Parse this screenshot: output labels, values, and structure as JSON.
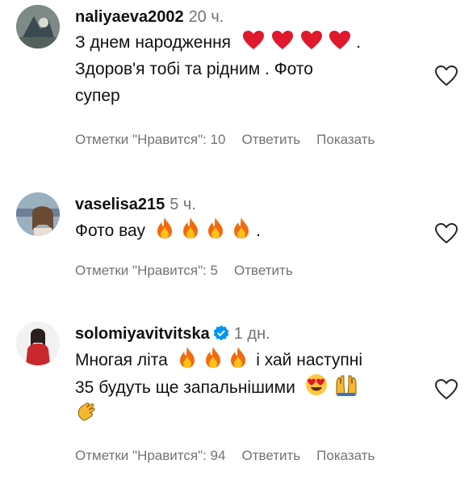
{
  "comments": [
    {
      "username": "naliyaeva2002",
      "time": "20 ч.",
      "lines": [
        "З днем народження",
        "Здоров'я тобі та рідним . Фото",
        "супер"
      ],
      "line1_suffix": ".",
      "emoji": [
        "red-heart",
        "red-heart",
        "red-heart",
        "red-heart"
      ],
      "likes_label": "Отметки \"Нравится\": 10",
      "reply_label": "Ответить",
      "show_label": "Показать"
    },
    {
      "username": "vaselisa215",
      "time": "5 ч.",
      "lines": [
        "Фото вау"
      ],
      "line1_suffix": ".",
      "emoji": [
        "fire",
        "fire",
        "fire",
        "fire"
      ],
      "likes_label": "Отметки \"Нравится\": 5",
      "reply_label": "Ответить"
    },
    {
      "username": "solomiyavitvitska",
      "time": "1 дн.",
      "verified": true,
      "lines": [
        "Многая літа",
        "і хай наступні",
        "35 будуть ще запальнішими"
      ],
      "emoji": [
        "fire",
        "fire",
        "fire",
        "heart-eyes",
        "raising-hands",
        "clapping-hands"
      ],
      "likes_label": "Отметки \"Нравится\": 94",
      "reply_label": "Ответить",
      "show_label": "Показать"
    }
  ],
  "colors": {
    "muted": "#737373",
    "verified": "#0095f6"
  }
}
